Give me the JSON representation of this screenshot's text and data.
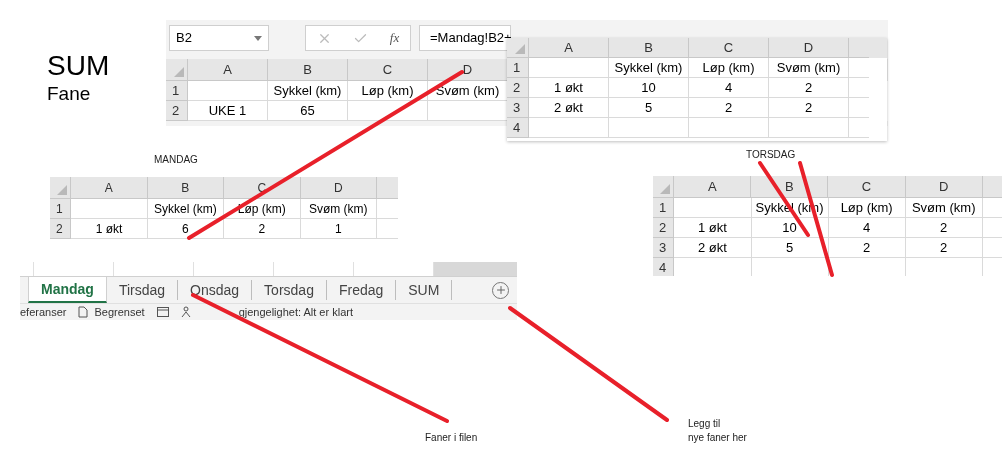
{
  "heading": {
    "title": "SUM",
    "subtitle": "Fane"
  },
  "summary_sheet": {
    "name_box": "B2",
    "function_label": "fx",
    "formula": "=Mandag!B2+",
    "columns": [
      "A",
      "B",
      "C",
      "D"
    ],
    "rows": [
      {
        "number": "1",
        "cells": [
          null,
          "Sykkel (km)",
          "Løp (km)",
          "Svøm (km)"
        ]
      },
      {
        "number": "2",
        "cells": [
          "UKE 1",
          "65",
          null,
          null
        ]
      }
    ]
  },
  "overlay_sheet": {
    "columns": [
      "A",
      "B",
      "C",
      "D"
    ],
    "rows": [
      {
        "number": "1",
        "cells": [
          null,
          "Sykkel (km)",
          "Løp (km)",
          "Svøm (km)"
        ]
      },
      {
        "number": "2",
        "cells": [
          "1 økt",
          "10",
          "4",
          "2"
        ]
      },
      {
        "number": "3",
        "cells": [
          "2 økt",
          "5",
          "2",
          "2"
        ]
      },
      {
        "number": "4"
      }
    ]
  },
  "monday": {
    "label": "MANDAG",
    "columns": [
      "A",
      "B",
      "C",
      "D"
    ],
    "rows": [
      {
        "number": "1",
        "cells": [
          null,
          "Sykkel (km)",
          "Løp (km)",
          "Svøm (km)"
        ]
      },
      {
        "number": "2",
        "cells": [
          "1 økt",
          "6",
          "2",
          "1"
        ]
      }
    ]
  },
  "sheet_tabs": [
    {
      "label": "Mandag",
      "selected": true
    },
    {
      "label": "Tirsdag",
      "selected": false
    },
    {
      "label": "Onsdag",
      "selected": false
    },
    {
      "label": "Torsdag",
      "selected": false
    },
    {
      "label": "Fredag",
      "selected": false
    },
    {
      "label": "SUM",
      "selected": false
    }
  ],
  "status_bar": [
    "eferanser",
    "Begrenset",
    "gjengelighet: Alt er klart"
  ],
  "thursday": {
    "label": "TORSDAG",
    "columns": [
      "A",
      "B",
      "C",
      "D"
    ],
    "rows": [
      {
        "number": "1",
        "cells": [
          null,
          "Sykkel (km)",
          "Løp (km)",
          "Svøm (km)"
        ]
      },
      {
        "number": "2",
        "cells": [
          "1 økt",
          "10",
          "4",
          "2"
        ]
      },
      {
        "number": "3",
        "cells": [
          "2 økt",
          "5",
          "2",
          "2"
        ]
      },
      {
        "number": "4"
      }
    ]
  },
  "captions": {
    "tabs": "Faner i filen",
    "add": [
      "Legg til",
      "nye faner her"
    ]
  }
}
